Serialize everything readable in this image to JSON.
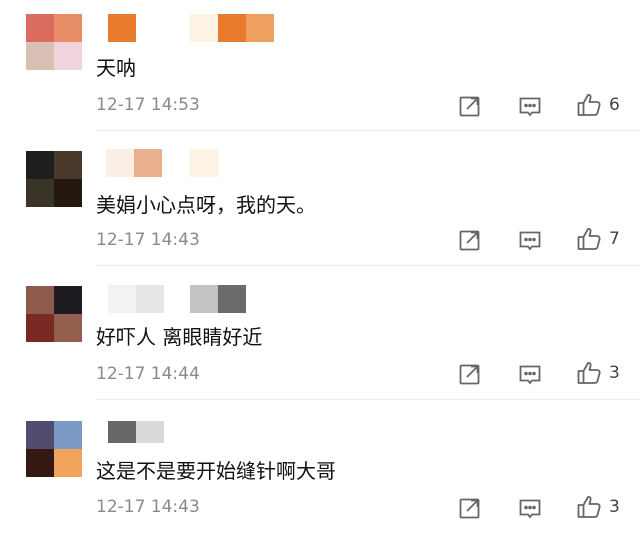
{
  "comments": [
    {
      "text": "天呐",
      "time": "12-17 14:53",
      "likes": "6",
      "avatar_colors": [
        "#d96b5f",
        "#e88f6a",
        "#d9c0b4",
        "#f1d3dc"
      ],
      "nick_colors": [
        "#e97b2d",
        "#fdf3e4",
        "#e97b2d",
        "#efa060"
      ]
    },
    {
      "text": "美娟小心点呀，我的天。",
      "time": "12-17 14:43",
      "likes": "7",
      "avatar_colors": [
        "#1e1e1e",
        "#4a3a2c",
        "#3a3327",
        "#24180f"
      ],
      "nick_colors": [
        "#fbeee4",
        "#e9b08e",
        "#fdf3e4"
      ]
    },
    {
      "text": "好吓人 离眼睛好近",
      "time": "12-17 14:44",
      "likes": "3",
      "avatar_colors": [
        "#8d5a4b",
        "#1e1c22",
        "#7a2a24",
        "#945e4e"
      ],
      "nick_colors": [
        "#f2f2f2",
        "#e6e6e6",
        "#c3c3c3",
        "#6b6b6b"
      ]
    },
    {
      "text": "这是不是要开始缝针啊大哥",
      "time": "12-17 14:43",
      "likes": "3",
      "avatar_colors": [
        "#544c6e",
        "#7b9bc6",
        "#341812",
        "#f1a45b"
      ],
      "nick_colors": [
        "#676767",
        "#d9d9d9"
      ]
    }
  ],
  "icons": {
    "repost": "share-icon",
    "comment": "comment-icon",
    "like": "thumbs-up-icon"
  }
}
